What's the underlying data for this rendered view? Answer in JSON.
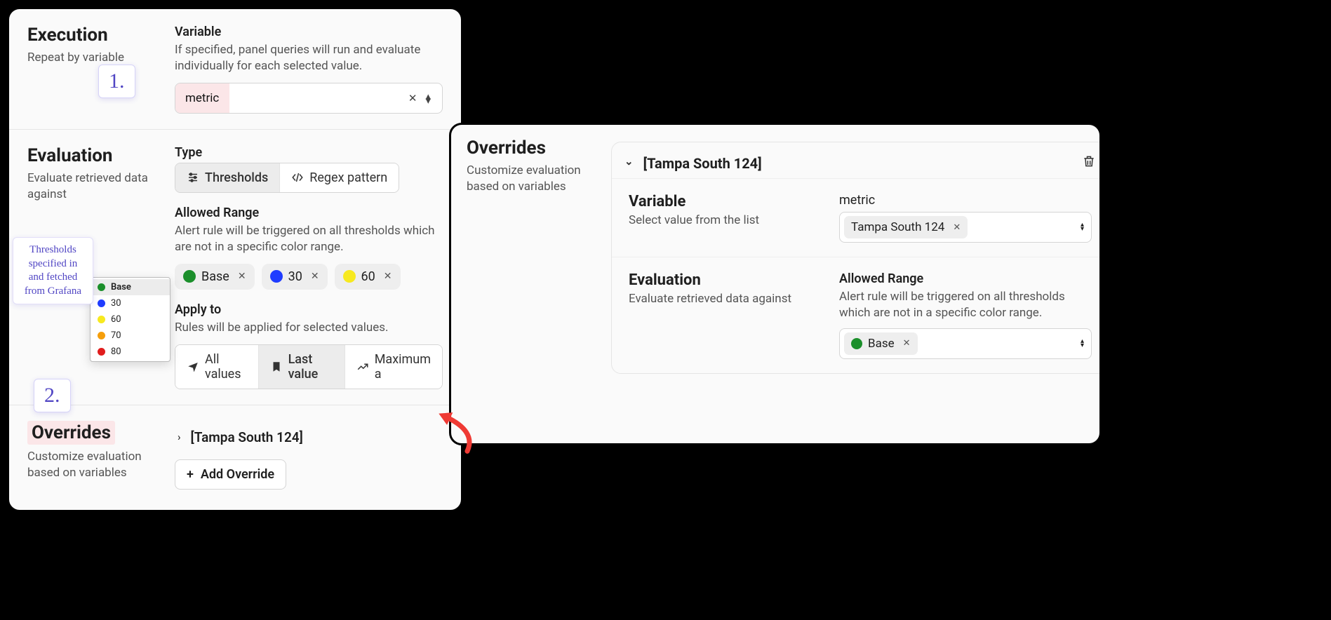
{
  "left_panel": {
    "execution": {
      "title": "Execution",
      "subtitle": "Repeat by variable",
      "variable_label": "Variable",
      "variable_desc": "If specified, panel queries will run and evaluate individually for each selected value.",
      "variable_value": "metric"
    },
    "evaluation": {
      "title": "Evaluation",
      "subtitle": "Evaluate retrieved data against",
      "type_label": "Type",
      "type_options": {
        "thresholds": "Thresholds",
        "regex": "Regex pattern"
      },
      "allowed_range_label": "Allowed Range",
      "allowed_range_desc": "Alert rule will be triggered on all thresholds which are not in a specific color range.",
      "pills": [
        {
          "label": "Base",
          "color": "green"
        },
        {
          "label": "30",
          "color": "blue"
        },
        {
          "label": "60",
          "color": "yellow"
        }
      ],
      "apply_to_label": "Apply to",
      "apply_to_desc": "Rules will be applied for selected values.",
      "apply_options": {
        "all": "All values",
        "last": "Last value",
        "max": "Maximum a"
      }
    },
    "overrides": {
      "title": "Overrides",
      "subtitle": "Customize evaluation based on variables",
      "item_label": "[Tampa South 124]",
      "add_label": "Add Override"
    }
  },
  "threshold_popup": {
    "items": [
      {
        "label": "Base",
        "color": "green",
        "selected": true
      },
      {
        "label": "30",
        "color": "blue"
      },
      {
        "label": "60",
        "color": "yellow"
      },
      {
        "label": "70",
        "color": "orange"
      },
      {
        "label": "80",
        "color": "red"
      }
    ]
  },
  "callouts": {
    "step1": "1.",
    "step2": "2.",
    "note": "Thresholds specified in and fetched from Grafana"
  },
  "right_panel": {
    "title": "Overrides",
    "subtitle": "Customize evaluation based on variables",
    "card": {
      "header": "[Tampa South 124]",
      "variable": {
        "title": "Variable",
        "subtitle": "Select value from the list",
        "field_label": "metric",
        "value": "Tampa South 124"
      },
      "evaluation": {
        "title": "Evaluation",
        "subtitle": "Evaluate retrieved data against",
        "allowed_range_label": "Allowed Range",
        "allowed_range_desc": "Alert rule will be triggered on all thresholds which are not in a specific color range.",
        "value": "Base",
        "value_color": "green"
      }
    }
  }
}
